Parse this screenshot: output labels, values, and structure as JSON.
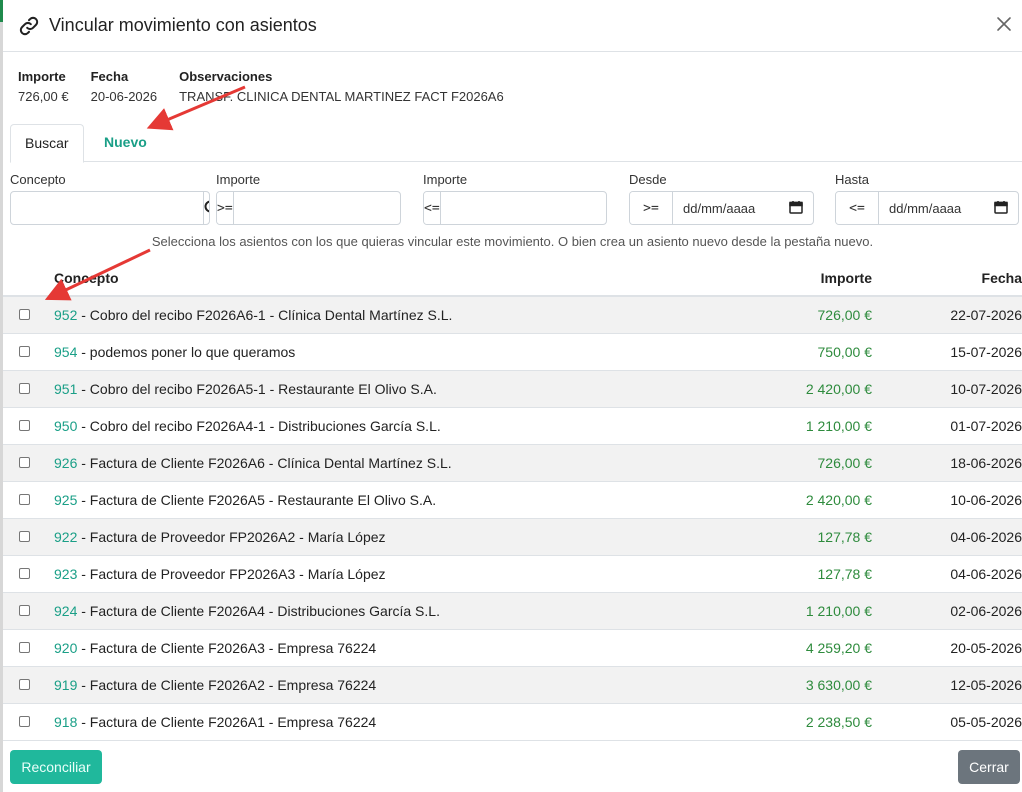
{
  "modal": {
    "title": "Vincular movimiento con asientos",
    "icons": {
      "title": "link-icon",
      "close": "close-icon"
    }
  },
  "summary": {
    "importe_label": "Importe",
    "importe_value": "726,00 €",
    "fecha_label": "Fecha",
    "fecha_value": "20-06-2026",
    "obs_label": "Observaciones",
    "obs_value": "TRANSF. CLINICA DENTAL MARTINEZ FACT F2026A6"
  },
  "tabs": [
    {
      "label": "Buscar",
      "active": true
    },
    {
      "label": "Nuevo",
      "active": false
    }
  ],
  "filters": {
    "concepto_label": "Concepto",
    "concepto_value": "",
    "importe_min_label": "Importe",
    "importe_min_op": ">=",
    "importe_min_value": "",
    "importe_max_label": "Importe",
    "importe_max_op": "<=",
    "importe_max_value": "",
    "desde_label": "Desde",
    "desde_op": ">=",
    "desde_placeholder": "dd/mm/aaaa",
    "hasta_label": "Hasta",
    "hasta_op": "<=",
    "hasta_placeholder": "dd/mm/aaaa"
  },
  "hint": "Selecciona los asientos con los que quieras vincular este movimiento. O bien crea un asiento nuevo desde la pestaña nuevo.",
  "table": {
    "headers": {
      "concepto": "Concepto",
      "importe": "Importe",
      "fecha": "Fecha"
    },
    "rows": [
      {
        "num": "952",
        "text": " - Cobro del recibo F2026A6-1 - Clínica Dental Martínez S.L.",
        "amount": "726,00 €",
        "date": "22-07-2026"
      },
      {
        "num": "954",
        "text": " - podemos poner lo que queramos",
        "amount": "750,00 €",
        "date": "15-07-2026"
      },
      {
        "num": "951",
        "text": " - Cobro del recibo F2026A5-1 - Restaurante El Olivo S.A.",
        "amount": "2 420,00 €",
        "date": "10-07-2026"
      },
      {
        "num": "950",
        "text": " - Cobro del recibo F2026A4-1 - Distribuciones García S.L.",
        "amount": "1 210,00 €",
        "date": "01-07-2026"
      },
      {
        "num": "926",
        "text": " - Factura de Cliente F2026A6 - Clínica Dental Martínez S.L.",
        "amount": "726,00 €",
        "date": "18-06-2026"
      },
      {
        "num": "925",
        "text": " - Factura de Cliente F2026A5 - Restaurante El Olivo S.A.",
        "amount": "2 420,00 €",
        "date": "10-06-2026"
      },
      {
        "num": "922",
        "text": " - Factura de Proveedor FP2026A2 - María López",
        "amount": "127,78 €",
        "date": "04-06-2026"
      },
      {
        "num": "923",
        "text": " - Factura de Proveedor FP2026A3 - María López",
        "amount": "127,78 €",
        "date": "04-06-2026"
      },
      {
        "num": "924",
        "text": " - Factura de Cliente F2026A4 - Distribuciones García S.L.",
        "amount": "1 210,00 €",
        "date": "02-06-2026"
      },
      {
        "num": "920",
        "text": " - Factura de Cliente F2026A3 - Empresa 76224",
        "amount": "4 259,20 €",
        "date": "20-05-2026"
      },
      {
        "num": "919",
        "text": " - Factura de Cliente F2026A2 - Empresa 76224",
        "amount": "3 630,00 €",
        "date": "12-05-2026"
      },
      {
        "num": "918",
        "text": " - Factura de Cliente F2026A1 - Empresa 76224",
        "amount": "2 238,50 €",
        "date": "05-05-2026"
      }
    ]
  },
  "footer": {
    "reconciliar": "Reconciliar",
    "cerrar": "Cerrar"
  },
  "colors": {
    "accent": "#1a9f87",
    "amount": "#2e8b3d",
    "primary_button": "#20b89c",
    "secondary_button": "#6c757d",
    "annotation_arrow": "#e53935"
  }
}
